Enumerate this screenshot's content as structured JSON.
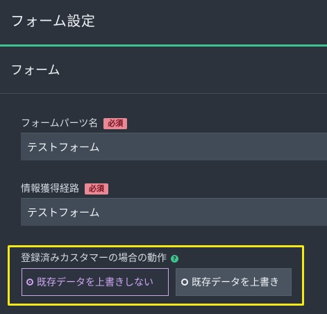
{
  "header": {
    "title": "フォーム設定"
  },
  "section": {
    "title": "フォーム"
  },
  "fields": [
    {
      "label": "フォームパーツ名",
      "badge": "必須",
      "value": "テストフォーム"
    },
    {
      "label": "情報獲得経路",
      "badge": "必須",
      "value": "テストフォーム"
    }
  ],
  "behavior": {
    "label": "登録済みカスタマーの場合の動作",
    "help_icon": "?",
    "options": [
      {
        "label": "既存データを上書きしない",
        "selected": true
      },
      {
        "label": "既存データを上書き",
        "selected": false
      }
    ]
  },
  "colors": {
    "accent": "#3fc48f",
    "highlight": "#f5ea14",
    "required_badge": "#e88a96",
    "selected_option": "#cfa6f2"
  }
}
